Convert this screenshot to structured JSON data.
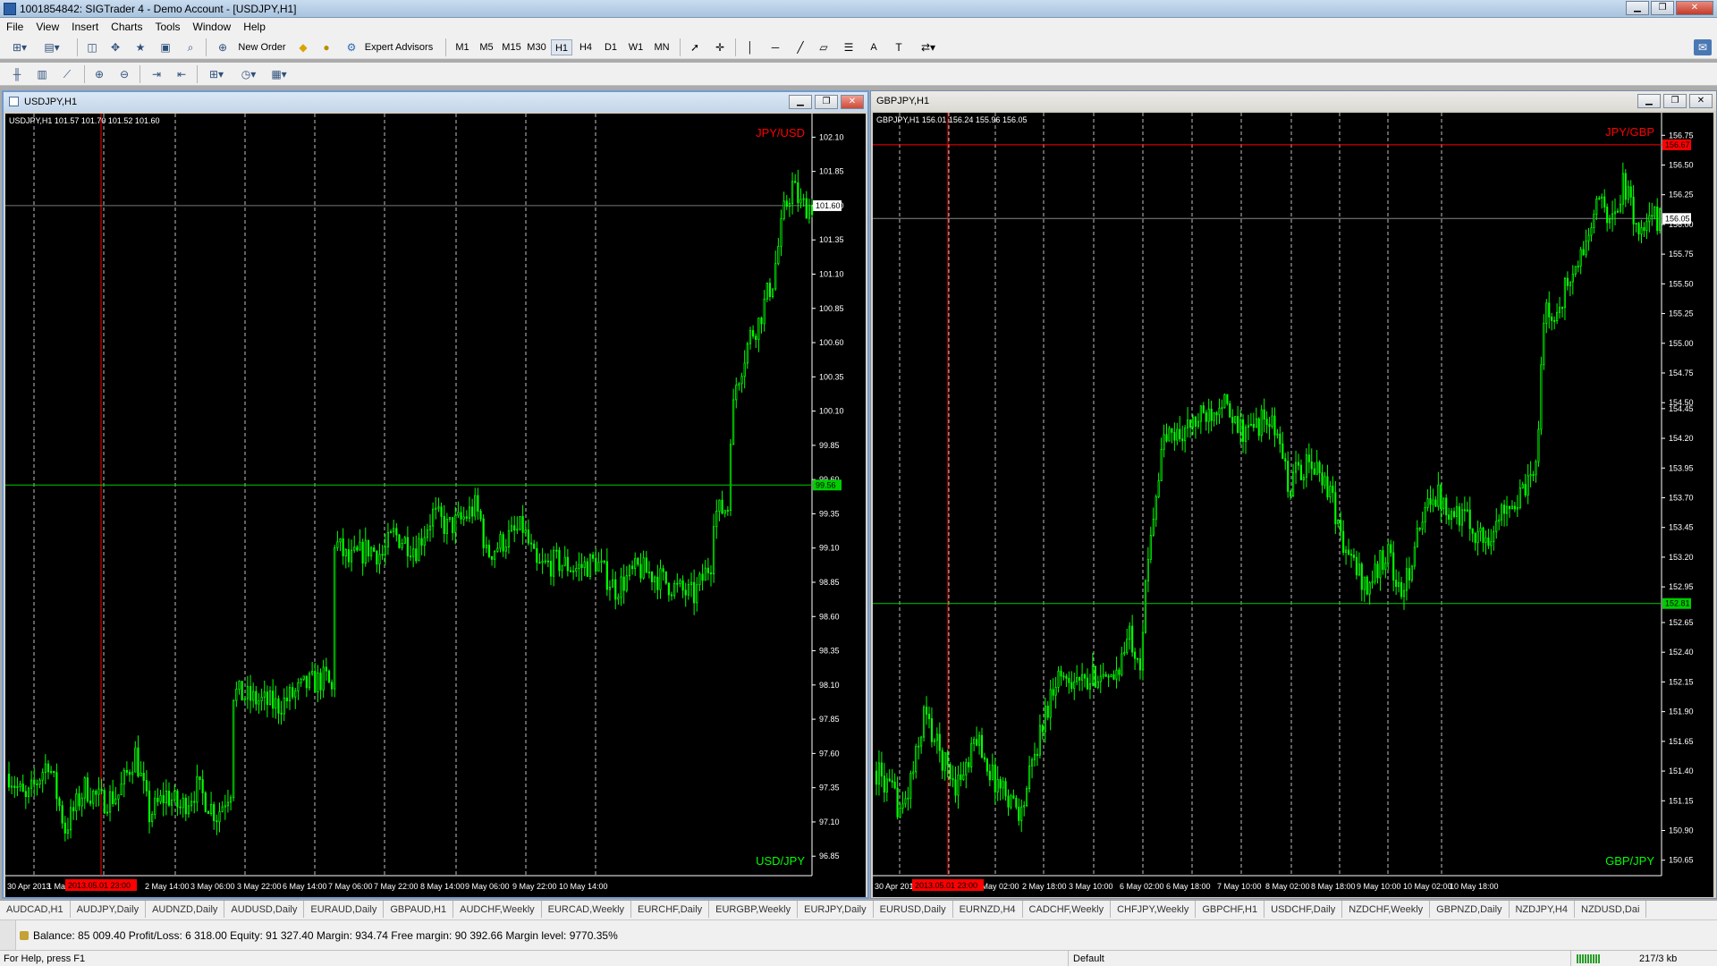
{
  "window": {
    "title": "1001854842: SIGTrader 4 - Demo Account - [USDJPY,H1]"
  },
  "menu": [
    "File",
    "View",
    "Insert",
    "Charts",
    "Tools",
    "Window",
    "Help"
  ],
  "toolbar": {
    "new_order": "New Order",
    "expert_advisors": "Expert Advisors",
    "timeframes": [
      "M1",
      "M5",
      "M15",
      "M30",
      "H1",
      "H4",
      "D1",
      "W1",
      "MN"
    ],
    "active_timeframe": "H1",
    "text_tool": "A"
  },
  "charts": [
    {
      "window_title": "USDJPY,H1",
      "header": "USDJPY,H1  101.57 101.70 101.52 101.60",
      "label_top": "JPY/USD",
      "label_bottom": "USD/JPY",
      "y_ticks": [
        "102.10",
        "101.85",
        "101.60",
        "101.35",
        "101.10",
        "100.85",
        "100.60",
        "100.35",
        "100.10",
        "99.85",
        "99.60",
        "99.35",
        "99.10",
        "98.85",
        "98.60",
        "98.35",
        "98.10",
        "97.85",
        "97.60",
        "97.35",
        "97.10",
        "96.85"
      ],
      "y_range": [
        96.76,
        102.22
      ],
      "x_ticks": [
        "30 Apr 2013",
        "1 May 2013",
        "2 May 14:00",
        "3 May 06:00",
        "3 May 22:00",
        "6 May 14:00",
        "7 May 06:00",
        "7 May 22:00",
        "8 May 14:00",
        "9 May 06:00",
        "9 May 22:00",
        "10 May 14:00"
      ],
      "cursor_time": "2013.05.01 23:00",
      "price_line": 101.6,
      "price_label": "101.60",
      "h_line": 99.56,
      "h_line_label": "99.56",
      "colors": {
        "bull": "#00ff00",
        "bear": "#00ff00",
        "bg": "#000000",
        "fg": "#ffffff",
        "grid": "#c0c0c0",
        "red": "#ff0000",
        "price_line": "#777777",
        "h_line": "#00cc00",
        "label_top": "#ff0000",
        "label_bottom": "#00ff00"
      },
      "chart_data": {
        "type": "candlestick",
        "keys": [
          [
            0,
            97.45
          ],
          [
            6,
            97.25
          ],
          [
            14,
            97.55
          ],
          [
            20,
            97.05
          ],
          [
            27,
            97.35
          ],
          [
            33,
            97.25
          ],
          [
            39,
            97.3
          ],
          [
            45,
            97.6
          ],
          [
            50,
            97.15
          ],
          [
            56,
            97.3
          ],
          [
            61,
            97.2
          ],
          [
            67,
            97.35
          ],
          [
            74,
            97.15
          ],
          [
            79,
            97.35
          ],
          [
            80,
            98.05
          ],
          [
            86,
            98.0
          ],
          [
            96,
            97.95
          ],
          [
            106,
            98.1
          ],
          [
            113,
            98.15
          ],
          [
            115,
            98.05
          ],
          [
            116,
            99.15
          ],
          [
            121,
            99.0
          ],
          [
            128,
            99.1
          ],
          [
            133,
            99.05
          ],
          [
            137,
            99.2
          ],
          [
            145,
            99.1
          ],
          [
            151,
            99.35
          ],
          [
            156,
            99.25
          ],
          [
            161,
            99.3
          ],
          [
            166,
            99.4
          ],
          [
            168,
            99.3
          ],
          [
            170,
            99.05
          ],
          [
            176,
            99.15
          ],
          [
            183,
            99.25
          ],
          [
            188,
            98.95
          ],
          [
            195,
            99.0
          ],
          [
            202,
            98.95
          ],
          [
            209,
            99.0
          ],
          [
            216,
            98.8
          ],
          [
            224,
            98.95
          ],
          [
            230,
            98.9
          ],
          [
            238,
            98.8
          ],
          [
            244,
            98.75
          ],
          [
            250,
            99.0
          ],
          [
            251,
            99.35
          ],
          [
            256,
            99.4
          ],
          [
            257,
            99.95
          ],
          [
            259,
            100.3
          ],
          [
            264,
            100.65
          ],
          [
            267,
            100.75
          ],
          [
            270,
            100.95
          ],
          [
            272,
            101.05
          ],
          [
            276,
            101.55
          ],
          [
            279,
            101.75
          ],
          [
            282,
            101.6
          ],
          [
            286,
            101.6
          ]
        ]
      }
    },
    {
      "window_title": "GBPJPY,H1",
      "header": "GBPJPY,H1  156.01 156.24 155.96 156.05",
      "label_top": "JPY/GBP",
      "label_bottom": "GBP/JPY",
      "y_ticks": [
        "156.75",
        "156.50",
        "156.25",
        "156.00",
        "155.75",
        "155.50",
        "155.25",
        "155.00",
        "154.75",
        "154.50",
        "154.45",
        "154.20",
        "153.95",
        "153.70",
        "153.45",
        "153.20",
        "152.95",
        "152.65",
        "152.40",
        "152.15",
        "151.90",
        "151.65",
        "151.40",
        "151.15",
        "150.90",
        "150.65"
      ],
      "y_range": [
        150.58,
        156.88
      ],
      "x_ticks": [
        "30 Apr 2013",
        "1 May 2013",
        "2 May 02:00",
        "2 May 18:00",
        "3 May 10:00",
        "6 May 02:00",
        "6 May 18:00",
        "7 May 10:00",
        "8 May 02:00",
        "8 May 18:00",
        "9 May 10:00",
        "10 May 02:00",
        "10 May 18:00"
      ],
      "cursor_time": "2013.05.01 23:00",
      "price_line": 156.05,
      "price_label": "156.05",
      "top_line": 156.67,
      "top_line_label": "156.67",
      "h_line": 152.81,
      "h_line_label": "152.81",
      "colors": {
        "bull": "#00ff00",
        "bear": "#00ff00",
        "bg": "#000000",
        "fg": "#ffffff",
        "grid": "#c0c0c0",
        "red": "#ff0000",
        "price_line": "#888888",
        "h_line": "#00cc00",
        "label_top": "#ff0000",
        "label_bottom": "#00ff00"
      },
      "chart_data": {
        "type": "candlestick",
        "keys": [
          [
            0,
            151.4
          ],
          [
            6,
            151.2
          ],
          [
            10,
            151.05
          ],
          [
            16,
            151.6
          ],
          [
            18,
            151.9
          ],
          [
            24,
            151.55
          ],
          [
            30,
            151.3
          ],
          [
            35,
            151.45
          ],
          [
            38,
            151.7
          ],
          [
            44,
            151.35
          ],
          [
            50,
            151.2
          ],
          [
            55,
            151.05
          ],
          [
            58,
            151.35
          ],
          [
            63,
            151.8
          ],
          [
            68,
            152.2
          ],
          [
            74,
            152.2
          ],
          [
            80,
            152.1
          ],
          [
            84,
            152.25
          ],
          [
            88,
            152.1
          ],
          [
            94,
            152.4
          ],
          [
            96,
            152.55
          ],
          [
            100,
            152.35
          ],
          [
            104,
            153.45
          ],
          [
            109,
            154.2
          ],
          [
            116,
            154.25
          ],
          [
            122,
            154.35
          ],
          [
            127,
            154.45
          ],
          [
            131,
            154.55
          ],
          [
            135,
            154.3
          ],
          [
            141,
            154.25
          ],
          [
            146,
            154.35
          ],
          [
            150,
            154.3
          ],
          [
            154,
            154.1
          ],
          [
            156,
            153.75
          ],
          [
            160,
            153.95
          ],
          [
            165,
            153.95
          ],
          [
            169,
            153.9
          ],
          [
            173,
            153.7
          ],
          [
            176,
            153.35
          ],
          [
            179,
            153.2
          ],
          [
            182,
            153.1
          ],
          [
            186,
            152.95
          ],
          [
            190,
            153.1
          ],
          [
            194,
            153.3
          ],
          [
            197,
            152.95
          ],
          [
            200,
            152.9
          ],
          [
            204,
            153.3
          ],
          [
            207,
            153.45
          ],
          [
            210,
            153.75
          ],
          [
            214,
            153.7
          ],
          [
            218,
            153.6
          ],
          [
            222,
            153.55
          ],
          [
            226,
            153.45
          ],
          [
            230,
            153.35
          ],
          [
            235,
            153.45
          ],
          [
            239,
            153.7
          ],
          [
            242,
            153.65
          ],
          [
            246,
            153.75
          ],
          [
            249,
            153.85
          ],
          [
            251,
            154.35
          ],
          [
            253,
            155.25
          ],
          [
            257,
            155.2
          ],
          [
            261,
            155.45
          ],
          [
            265,
            155.6
          ],
          [
            269,
            155.85
          ],
          [
            272,
            156.05
          ],
          [
            275,
            156.25
          ],
          [
            279,
            156.0
          ],
          [
            283,
            156.35
          ],
          [
            286,
            156.15
          ],
          [
            290,
            155.9
          ],
          [
            294,
            156.05
          ],
          [
            297,
            156.05
          ]
        ]
      }
    }
  ],
  "symbol_tabs": [
    "AUDCAD,H1",
    "AUDJPY,Daily",
    "AUDNZD,Daily",
    "AUDUSD,Daily",
    "EURAUD,Daily",
    "GBPAUD,H1",
    "AUDCHF,Weekly",
    "EURCAD,Weekly",
    "EURCHF,Daily",
    "EURGBP,Weekly",
    "EURJPY,Daily",
    "EURUSD,Daily",
    "EURNZD,H4",
    "CADCHF,Weekly",
    "CHFJPY,Weekly",
    "GBPCHF,H1",
    "USDCHF,Daily",
    "NZDCHF,Weekly",
    "GBPNZD,Daily",
    "NZDJPY,H4",
    "NZDUSD,Dai"
  ],
  "account": {
    "summary": "Balance: 85 009.40  Profit/Loss: 6 318.00  Equity: 91 327.40  Margin: 934.74  Free margin: 90 392.66  Margin level: 9770.35%"
  },
  "status": {
    "help": "For Help, press F1",
    "profile": "Default",
    "traffic": "217/3 kb"
  }
}
